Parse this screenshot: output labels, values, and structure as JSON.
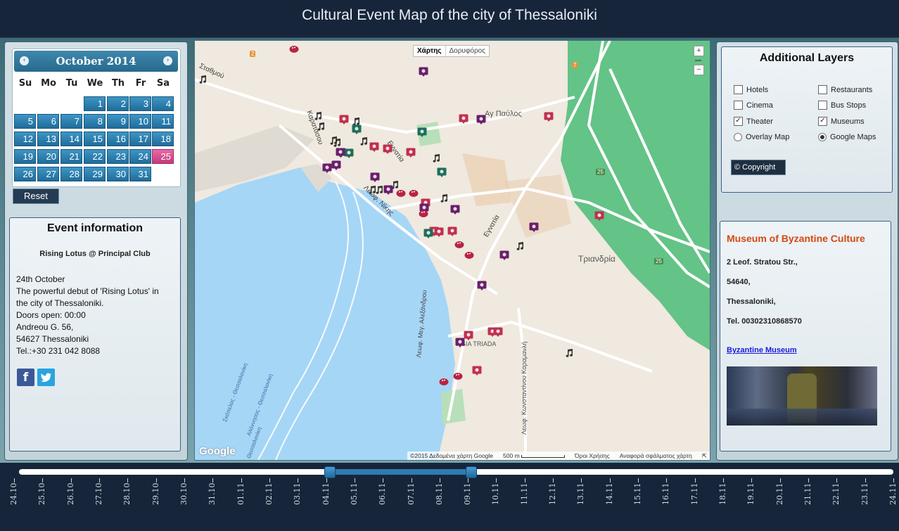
{
  "header": {
    "title": "Cultural Event Map of the city of Thessaloniki"
  },
  "calendar": {
    "month_label": "October 2014",
    "prev_icon": "‹",
    "next_icon": "›",
    "weekdays": [
      "Su",
      "Mo",
      "Tu",
      "We",
      "Th",
      "Fr",
      "Sa"
    ],
    "days": [
      "1",
      "2",
      "3",
      "4",
      "5",
      "6",
      "7",
      "8",
      "9",
      "10",
      "11",
      "12",
      "13",
      "14",
      "15",
      "16",
      "17",
      "18",
      "19",
      "20",
      "21",
      "22",
      "23",
      "24",
      "25",
      "26",
      "27",
      "28",
      "29",
      "30",
      "31"
    ],
    "selected_day": "25",
    "reset_label": "Reset"
  },
  "event": {
    "title": "Event information",
    "name": "Rising Lotus @ Principal Club",
    "lines": [
      "24th October",
      "The powerful debut of 'Rising Lotus' in",
      "the city of Thessaloniki.",
      "Doors open: 00:00",
      "Andreou G. 56,",
      "54627 Thessaloniki",
      "Tel.:+30 231 042 8088"
    ],
    "facebook_icon": "f",
    "twitter_icon": "twitter-icon"
  },
  "map": {
    "tabs": [
      "Χάρτης",
      "Δορυφόρος"
    ],
    "zoom_in": "+",
    "zoom_out": "−",
    "logo": "Google",
    "labels": {
      "ag_pavlos": "Αγ Παύλος",
      "triandria": "Τριανδρία",
      "agia_triada": "AGIA TRIADA",
      "egnatia1": "Εγνατία",
      "egnatia2": "Εγνατία",
      "nikis": "Λεωφ. Νίκης",
      "karatasou": "Καρατάσου",
      "stathmou": "Σταθμού",
      "alexandrou": "Λεωφ. Μεγ. Αλεξάνδρου",
      "karamanli": "Λεωφ. Κωνσταντίνου Καραμανλή",
      "ferry1": "Σκόπελος - Θεσσαλονίκη",
      "ferry2": "Αλόννησος - Θεσσαλονίκη",
      "ferry3": "Θεσσαλονίκη",
      "road25a": "25",
      "road25b": "25",
      "road2": "2",
      "road7": "7"
    },
    "footer": [
      "©2015 Δεδομένα χάρτη Google",
      "500 m",
      "Όροι Χρήσης",
      "Αναφορά σφάλματος χάρτη"
    ]
  },
  "layers": {
    "title": "Additional Layers",
    "options": [
      {
        "label": "Hotels",
        "checked": false
      },
      {
        "label": "Restaurants",
        "checked": false
      },
      {
        "label": "Cinema",
        "checked": false
      },
      {
        "label": "Bus Stops",
        "checked": false
      },
      {
        "label": "Theater",
        "checked": true
      },
      {
        "label": "Museums",
        "checked": true
      }
    ],
    "radios": [
      {
        "label": "Overlay Map",
        "selected": false
      },
      {
        "label": "Google Maps",
        "selected": true
      }
    ],
    "copyright_label": "Copyright",
    "copyright_icon": "©"
  },
  "museum": {
    "name": "Museum of Byzantine Culture",
    "address": "2 Leof. Stratou Str.,",
    "postcode": "54640,",
    "city": "Thessaloniki,",
    "tel": "Tel. 00302310868570",
    "link": "Byzantine Museum"
  },
  "timeline": {
    "labels": [
      "24.10",
      "25.10",
      "26.10",
      "27.10",
      "28.10",
      "29.10",
      "30.10",
      "31.10",
      "01.11",
      "02.11",
      "03.11",
      "04.11",
      "05.11",
      "06.11",
      "07.11",
      "08.11",
      "09.11",
      "10.11",
      "11.11",
      "12.11",
      "13.11",
      "14.11",
      "15.11",
      "16.11",
      "17.11",
      "18.11",
      "19.11",
      "20.11",
      "21.11",
      "22.11",
      "23.11",
      "24.11"
    ],
    "range_start": "04.11",
    "range_end": "09.11"
  },
  "colors": {
    "header_bg": "#17253a",
    "accent_blue": "#1f6d9c",
    "selected_pink": "#d94a90",
    "museum_orange": "#d24a12",
    "theater_marker": "#c0304e",
    "museum_marker": "#6a1f6a"
  }
}
